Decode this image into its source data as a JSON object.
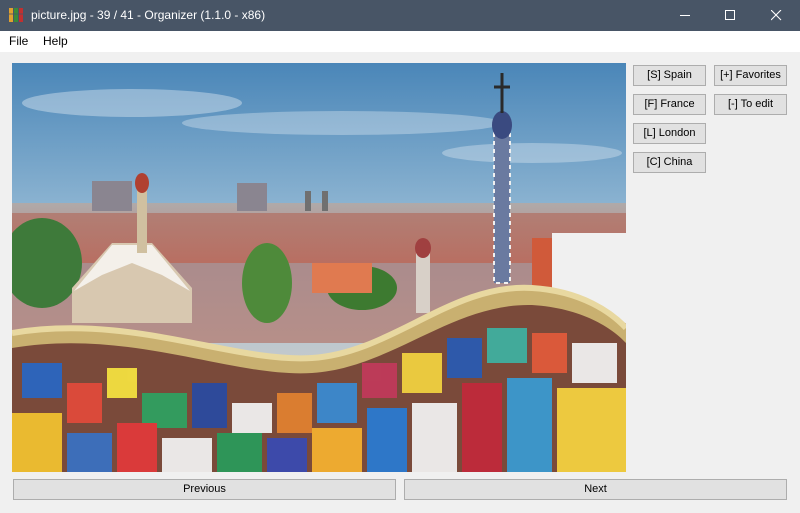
{
  "window": {
    "title": "picture.jpg - 39 / 41 - Organizer (1.1.0 - x86)",
    "titlebar_color": "#485566"
  },
  "menu": {
    "file": "File",
    "help": "Help"
  },
  "photo": {
    "description_icon": "park-guell-photo"
  },
  "tags": {
    "spain": "[S] Spain",
    "france": "[F] France",
    "london": "[L] London",
    "china": "[C] China",
    "favorites": "[+] Favorites",
    "to_edit": "[-] To edit"
  },
  "navigation": {
    "previous": "Previous",
    "next": "Next"
  }
}
